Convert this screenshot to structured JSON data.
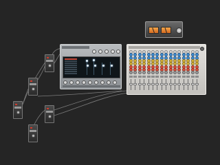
{
  "workspace": {
    "background": "#252525",
    "cable_color": "#8c8c8c"
  },
  "devices": [
    {
      "id": "device-1",
      "led": "#d23b2b"
    },
    {
      "id": "device-2",
      "led": "#d23b2b"
    },
    {
      "id": "device-3",
      "led": "#d23b2b"
    },
    {
      "id": "device-4",
      "led": "#d23b2b"
    },
    {
      "id": "device-5",
      "led": "#d23b2b"
    }
  ],
  "synth": {
    "display_background": "#0f1519",
    "accent": "#c84a3a"
  },
  "mixer": {
    "channel_count": 16,
    "knob_colors": [
      "#d6d6d6",
      "#3f8fd8",
      "#3f8fd8",
      "#d9b43a",
      "#d9b43a",
      "#e0503a",
      "#e0503a",
      "#9a9a9a"
    ]
  },
  "vu_unit": {
    "meter_color": "#e88a36",
    "meters": 2
  }
}
